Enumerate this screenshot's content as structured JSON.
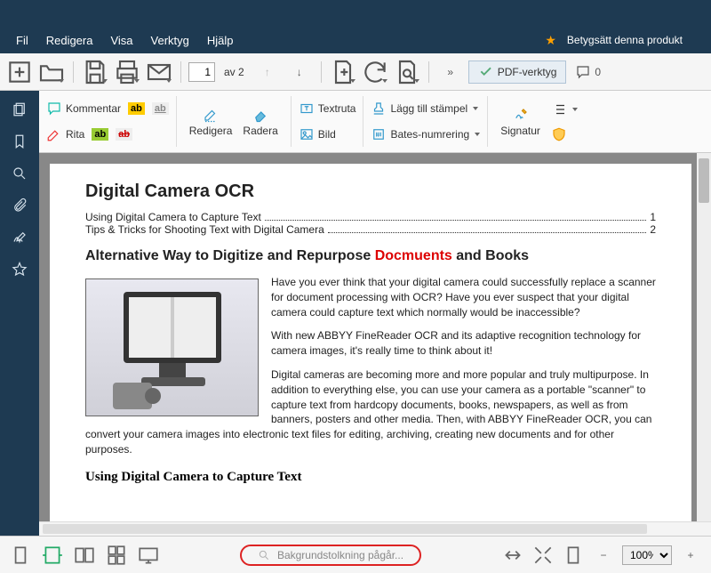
{
  "menubar": {
    "items": [
      "Fil",
      "Redigera",
      "Visa",
      "Verktyg",
      "Hjälp"
    ],
    "rate_label": "Betygsätt denna produkt"
  },
  "toolbar": {
    "page_current": "1",
    "page_total": "av 2",
    "pdf_tools_label": "PDF-verktyg",
    "comment_count": "0"
  },
  "ribbon": {
    "comment": "Kommentar",
    "draw": "Rita",
    "hl_text": "ab",
    "edit": "Redigera",
    "erase": "Radera",
    "textbox": "Textruta",
    "image": "Bild",
    "stamp": "Lägg till stämpel",
    "bates": "Bates-numrering",
    "signature": "Signatur"
  },
  "document": {
    "title": "Digital Camera OCR",
    "toc1_text": "Using Digital Camera to Capture Text",
    "toc1_page": "1",
    "toc2_text": "Tips & Tricks for Shooting Text with Digital Camera",
    "toc2_page": "2",
    "h2_a": "Alternative Way to Digitize and Repurpose ",
    "h2_typo": "Docmuents",
    "h2_b": " and Books",
    "p1": "Have you ever think that your digital camera could successfully replace a scanner for document processing with OCR? Have you ever suspect that your digital camera could capture text which normally would be inaccessible?",
    "p2": "With new ABBYY FineReader OCR and its adaptive recognition technology  for camera images, it's really time to think about it!",
    "p3": "Digital cameras are becoming more and more popular and truly multipurpose. In addition to everything else, you can use your camera as a portable \"scanner\" to capture text from hardcopy documents, books, newspapers, as well as from banners, posters and other media. Then, with ABBYY FineReader OCR, you can convert your camera images into electronic text files for editing, archiving, creating new documents and for other purposes.",
    "h3": "Using Digital Camera to Capture Text"
  },
  "statusbar": {
    "bg_task": "Bakgrundstolkning pågår...",
    "zoom": "100%"
  }
}
